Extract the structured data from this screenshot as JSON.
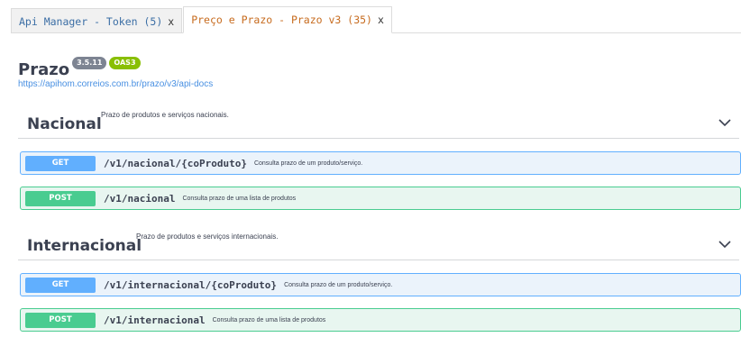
{
  "tabs": [
    {
      "label": "Api Manager - Token (5)",
      "close": "x"
    },
    {
      "label": "Preço e Prazo - Prazo v3 (35)",
      "close": "x"
    }
  ],
  "api": {
    "title": "Prazo",
    "version": "3.5.11",
    "oas": "OAS3",
    "url": "https://apihom.correios.com.br/prazo/v3/api-docs"
  },
  "sections": [
    {
      "name": "Nacional",
      "description": "Prazo de produtos e serviços nacionais.",
      "operations": [
        {
          "method": "GET",
          "path": "/v1/nacional/{coProduto}",
          "summary": "Consulta prazo de um produto/serviço."
        },
        {
          "method": "POST",
          "path": "/v1/nacional",
          "summary": "Consulta prazo de uma lista de produtos"
        }
      ]
    },
    {
      "name": "Internacional",
      "description": "Prazo de produtos e serviços internacionais.",
      "operations": [
        {
          "method": "GET",
          "path": "/v1/internacional/{coProduto}",
          "summary": "Consulta prazo de um produto/serviço."
        },
        {
          "method": "POST",
          "path": "/v1/internacional",
          "summary": "Consulta prazo de uma lista de produtos"
        }
      ]
    }
  ],
  "colors": {
    "get": "#61affe",
    "post": "#49cc90",
    "link": "#4990e2",
    "tab_active": "#c76b1e"
  },
  "icons": {
    "expand": "chevron-down-icon"
  }
}
